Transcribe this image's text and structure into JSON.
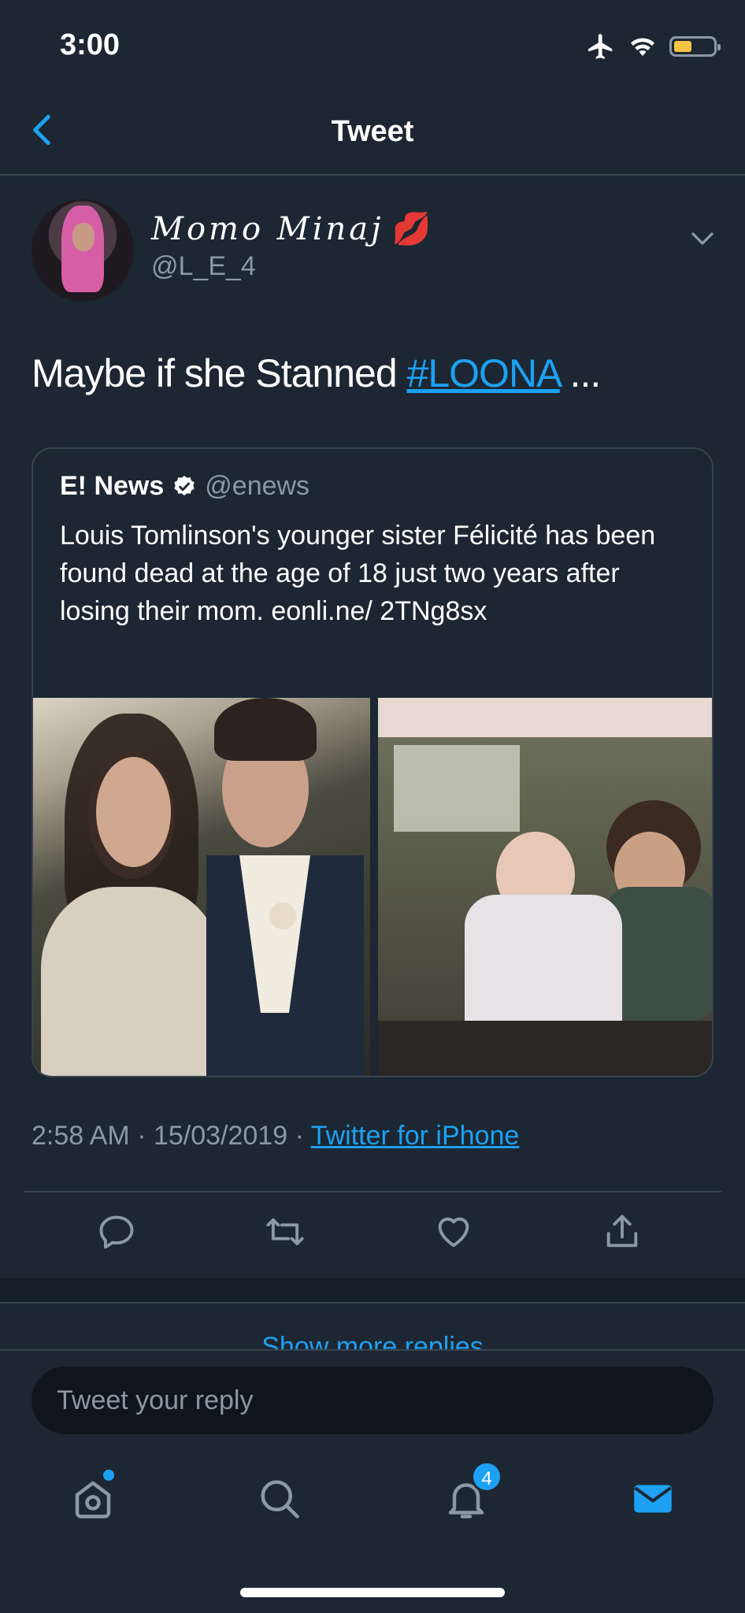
{
  "status_bar": {
    "time": "3:00",
    "icons": [
      "airplane-icon",
      "wifi-icon",
      "battery-icon"
    ],
    "battery_color": "#f4c542"
  },
  "header": {
    "title": "Tweet",
    "back_icon": "chevron-left-icon"
  },
  "tweet": {
    "user_name": "Momo Minaj",
    "user_emoji": "💋",
    "user_handle": "@L_E_4",
    "text_before": "Maybe if she Stanned ",
    "hashtag": "#LOONA",
    "text_after": " ...",
    "timestamp": "2:58 AM · 15/03/2019 · ",
    "source": "Twitter for iPhone",
    "actions": [
      "reply-icon",
      "retweet-icon",
      "like-icon",
      "share-icon"
    ]
  },
  "quote": {
    "name": "E! News",
    "verified": true,
    "handle": "@enews",
    "text": "Louis Tomlinson's younger sister Félicité has been found dead at the age of 18 just two years after losing their mom. eonli.ne/ 2TNg8sx"
  },
  "replies": {
    "show_more": "Show more replies"
  },
  "reply_box": {
    "placeholder": "Tweet your reply"
  },
  "tab_bar": {
    "tabs": [
      "home-icon",
      "search-icon",
      "notifications-icon",
      "messages-icon"
    ],
    "notification_count": "4"
  },
  "colors": {
    "background": "#15202b",
    "surface": "#1c2733",
    "accent": "#1da1f2",
    "muted_text": "#8b98a5",
    "border": "#38444d"
  }
}
